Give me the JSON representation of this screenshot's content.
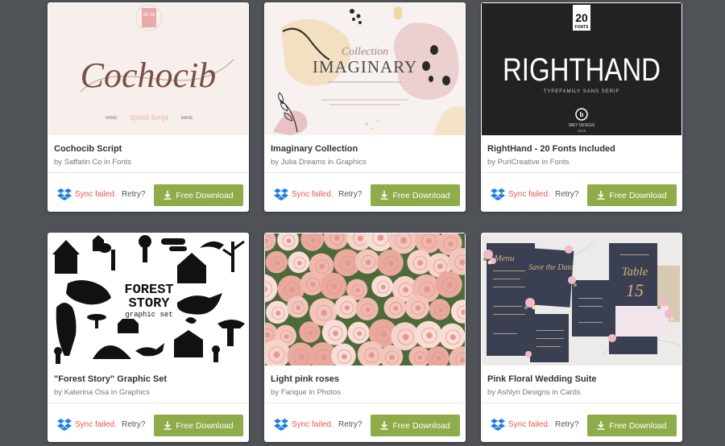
{
  "colors": {
    "background": "#4f5256",
    "download": "#8eac4a",
    "sync_error": "#e8574d",
    "dropbox": "#1e7ee6"
  },
  "cards": [
    {
      "title": "Cochocib Script",
      "by": "by",
      "author": "Saffatin Co",
      "in": "in",
      "category": "Fonts",
      "sync_status": "Sync failed.",
      "retry": "Retry?",
      "download": "Free Download",
      "thumb": {
        "name": "Cochocib",
        "badge": "20 18",
        "arc": "HAPPY CALLIGRAPHY CREATION",
        "left": "HAND",
        "middle": "Stylish Script",
        "right": "MADE"
      }
    },
    {
      "title": "Imaginary Collection",
      "by": "by",
      "author": "Julia Dreams",
      "in": "in",
      "category": "Graphics",
      "sync_status": "Sync failed.",
      "retry": "Retry?",
      "download": "Free Download",
      "thumb": {
        "script": "Collection",
        "name": "IMAGINARY"
      }
    },
    {
      "title": "RightHand - 20 Fonts Included",
      "by": "by",
      "author": "PuriCreative",
      "in": "in",
      "category": "Fonts",
      "sync_status": "Sync failed.",
      "retry": "Retry?",
      "download": "Free Download",
      "thumb": {
        "badge_num": "20",
        "badge_label": "FONTS",
        "name": "RIGHTHAND",
        "sub": "TYPEFAMILY SANS SERIF",
        "brand": "IBEY DESIGN",
        "year": "2019"
      }
    },
    {
      "title": "\"Forest Story\" Graphic Set",
      "by": "by",
      "author": "Katerina Osa",
      "in": "in",
      "category": "Graphics",
      "sync_status": "Sync failed.",
      "retry": "Retry?",
      "download": "Free Download",
      "thumb": {
        "line1": "FOREST",
        "line2": "STORY",
        "line3": "graphic set"
      }
    },
    {
      "title": "Light pink roses",
      "by": "by",
      "author": "Farique",
      "in": "in",
      "category": "Photos",
      "sync_status": "Sync failed.",
      "retry": "Retry?",
      "download": "Free Download",
      "thumb": {}
    },
    {
      "title": "Pink Floral Wedding Suite",
      "by": "by",
      "author": "Ashlyn Designs",
      "in": "in",
      "category": "Cards",
      "sync_status": "Sync failed.",
      "retry": "Retry?",
      "download": "Free Download",
      "thumb": {
        "menu": "Menu",
        "save": "Save the Date",
        "table": "Table",
        "num": "15"
      }
    }
  ]
}
